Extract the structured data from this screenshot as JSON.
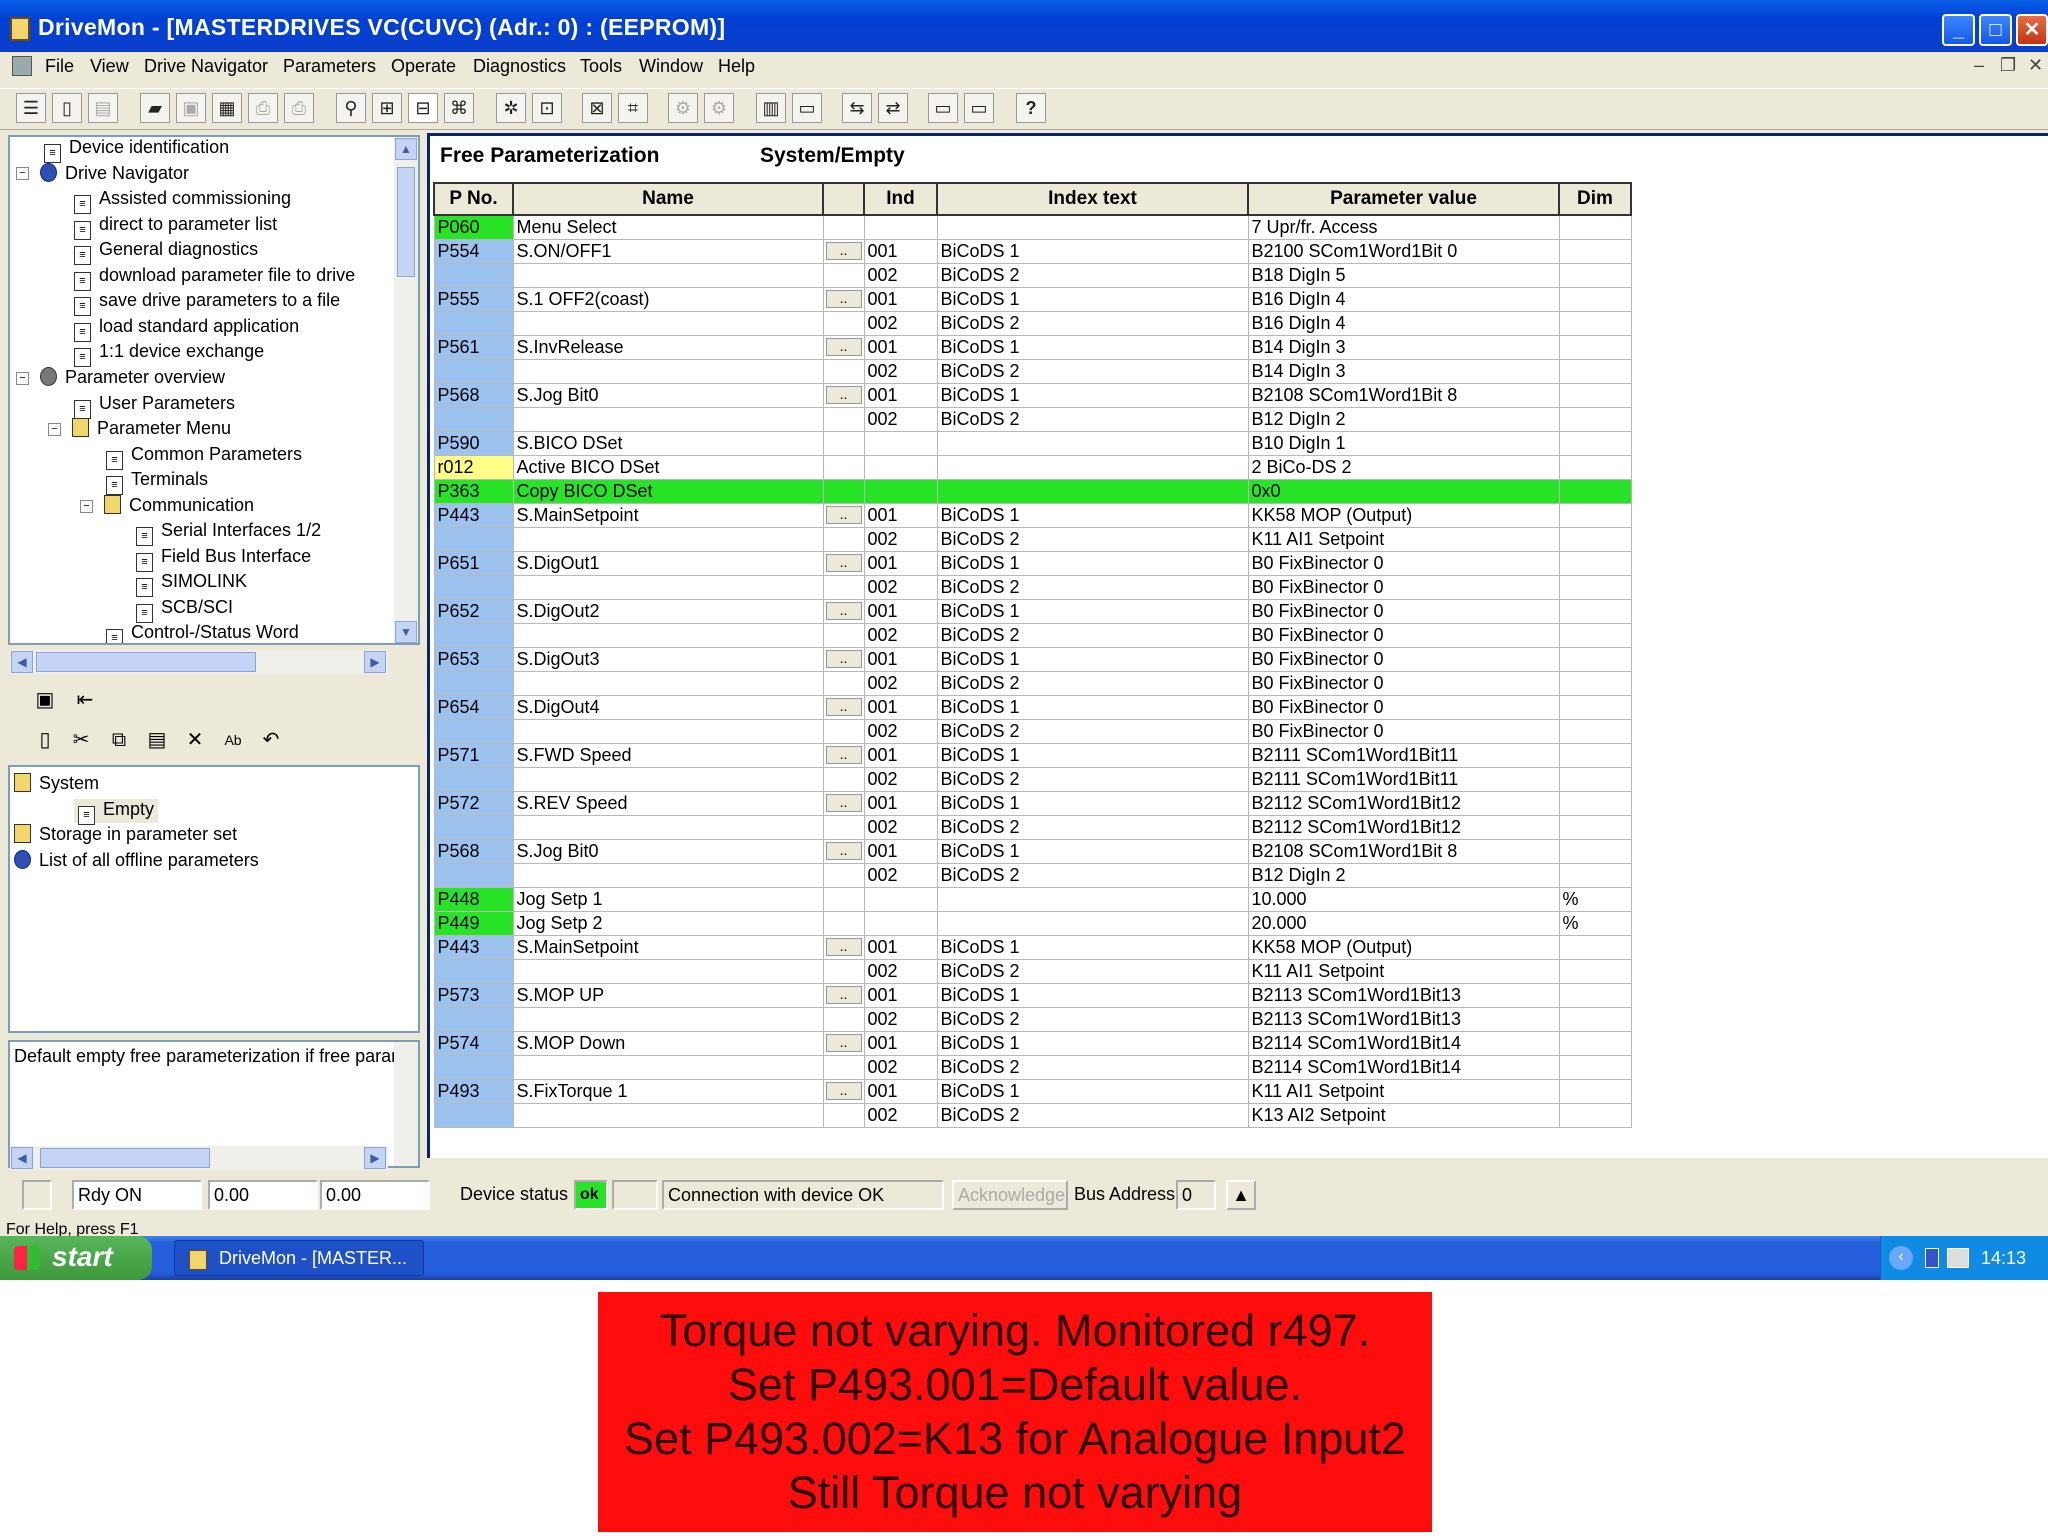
{
  "window": {
    "title": "DriveMon - [MASTERDRIVES VC(CUVC)  (Adr.: 0) : (EEPROM)]"
  },
  "menu": [
    "File",
    "View",
    "Drive Navigator",
    "Parameters",
    "Operate",
    "Diagnostics",
    "Tools",
    "Window",
    "Help"
  ],
  "tree": {
    "items": [
      "Device identification",
      "Drive Navigator",
      "Assisted commissioning",
      "direct to parameter list",
      "General diagnostics",
      "download parameter file to drive",
      "save drive parameters to a file",
      "load standard application",
      "1:1 device exchange",
      "Parameter overview",
      "User Parameters",
      "Parameter Menu",
      "Common Parameters",
      "Terminals",
      "Communication",
      "Serial Interfaces 1/2",
      "Field Bus Interface",
      "SIMOLINK",
      "SCB/SCI",
      "Control-/Status Word"
    ]
  },
  "paramsets": {
    "items": [
      "System",
      "Empty",
      "Storage in parameter set",
      "List of all offline parameters"
    ]
  },
  "description": "Default empty free parameterization if free parame",
  "grid": {
    "title": "Free Parameterization",
    "subtitle": "System/Empty",
    "headers": [
      "P No.",
      "Name",
      "",
      "Ind",
      "Index text",
      "Parameter value",
      "Dim"
    ],
    "rows": [
      {
        "p": "P060",
        "name": "Menu Select",
        "btn": "",
        "ind": "",
        "itext": "",
        "val": "7  Upr/fr. Access",
        "dim": "",
        "pc": "green"
      },
      {
        "p": "P554",
        "name": "S.ON/OFF1",
        "btn": "..",
        "ind": "001",
        "itext": "BiCoDS 1",
        "val": "B2100  SCom1Word1Bit 0",
        "dim": "",
        "pc": "blue"
      },
      {
        "p": "",
        "name": "",
        "btn": "",
        "ind": "002",
        "itext": "BiCoDS 2",
        "val": "B18  DigIn 5",
        "dim": "",
        "pc": "blue"
      },
      {
        "p": "P555",
        "name": "S.1 OFF2(coast)",
        "btn": "..",
        "ind": "001",
        "itext": "BiCoDS 1",
        "val": "B16  DigIn 4",
        "dim": "",
        "pc": "blue"
      },
      {
        "p": "",
        "name": "",
        "btn": "",
        "ind": "002",
        "itext": "BiCoDS 2",
        "val": "B16  DigIn 4",
        "dim": "",
        "pc": "blue"
      },
      {
        "p": "P561",
        "name": "S.InvRelease",
        "btn": "..",
        "ind": "001",
        "itext": "BiCoDS 1",
        "val": "B14  DigIn 3",
        "dim": "",
        "pc": "blue"
      },
      {
        "p": "",
        "name": "",
        "btn": "",
        "ind": "002",
        "itext": "BiCoDS 2",
        "val": "B14  DigIn 3",
        "dim": "",
        "pc": "blue"
      },
      {
        "p": "P568",
        "name": "S.Jog Bit0",
        "btn": "..",
        "ind": "001",
        "itext": "BiCoDS 1",
        "val": "B2108  SCom1Word1Bit 8",
        "dim": "",
        "pc": "blue"
      },
      {
        "p": "",
        "name": "",
        "btn": "",
        "ind": "002",
        "itext": "BiCoDS 2",
        "val": "B12  DigIn 2",
        "dim": "",
        "pc": "blue"
      },
      {
        "p": "P590",
        "name": "S.BICO DSet",
        "btn": "",
        "ind": "",
        "itext": "",
        "val": "B10  DigIn 1",
        "dim": "",
        "pc": "blue"
      },
      {
        "p": "r012",
        "name": "Active BICO DSet",
        "btn": "",
        "ind": "",
        "itext": "",
        "val": "2   BiCo-DS 2",
        "dim": "",
        "pc": "yellow"
      },
      {
        "p": "P363",
        "name": "Copy BICO DSet",
        "btn": "",
        "ind": "",
        "itext": "",
        "val": "0x0",
        "dim": "",
        "pc": "green",
        "hl": true
      },
      {
        "p": "P443",
        "name": "S.MainSetpoint",
        "btn": "..",
        "ind": "001",
        "itext": "BiCoDS 1",
        "val": "KK58  MOP (Output)",
        "dim": "",
        "pc": "blue"
      },
      {
        "p": "",
        "name": "",
        "btn": "",
        "ind": "002",
        "itext": "BiCoDS 2",
        "val": "K11  AI1 Setpoint",
        "dim": "",
        "pc": "blue"
      },
      {
        "p": "P651",
        "name": "S.DigOut1",
        "btn": "..",
        "ind": "001",
        "itext": "BiCoDS 1",
        "val": "B0  FixBinector 0",
        "dim": "",
        "pc": "blue"
      },
      {
        "p": "",
        "name": "",
        "btn": "",
        "ind": "002",
        "itext": "BiCoDS 2",
        "val": "B0  FixBinector 0",
        "dim": "",
        "pc": "blue"
      },
      {
        "p": "P652",
        "name": "S.DigOut2",
        "btn": "..",
        "ind": "001",
        "itext": "BiCoDS 1",
        "val": "B0  FixBinector 0",
        "dim": "",
        "pc": "blue"
      },
      {
        "p": "",
        "name": "",
        "btn": "",
        "ind": "002",
        "itext": "BiCoDS 2",
        "val": "B0  FixBinector 0",
        "dim": "",
        "pc": "blue"
      },
      {
        "p": "P653",
        "name": "S.DigOut3",
        "btn": "..",
        "ind": "001",
        "itext": "BiCoDS 1",
        "val": "B0  FixBinector 0",
        "dim": "",
        "pc": "blue"
      },
      {
        "p": "",
        "name": "",
        "btn": "",
        "ind": "002",
        "itext": "BiCoDS 2",
        "val": "B0  FixBinector 0",
        "dim": "",
        "pc": "blue"
      },
      {
        "p": "P654",
        "name": "S.DigOut4",
        "btn": "..",
        "ind": "001",
        "itext": "BiCoDS 1",
        "val": "B0  FixBinector 0",
        "dim": "",
        "pc": "blue"
      },
      {
        "p": "",
        "name": "",
        "btn": "",
        "ind": "002",
        "itext": "BiCoDS 2",
        "val": "B0  FixBinector 0",
        "dim": "",
        "pc": "blue"
      },
      {
        "p": "P571",
        "name": "S.FWD Speed",
        "btn": "..",
        "ind": "001",
        "itext": "BiCoDS 1",
        "val": "B2111  SCom1Word1Bit11",
        "dim": "",
        "pc": "blue"
      },
      {
        "p": "",
        "name": "",
        "btn": "",
        "ind": "002",
        "itext": "BiCoDS 2",
        "val": "B2111  SCom1Word1Bit11",
        "dim": "",
        "pc": "blue"
      },
      {
        "p": "P572",
        "name": "S.REV Speed",
        "btn": "..",
        "ind": "001",
        "itext": "BiCoDS 1",
        "val": "B2112  SCom1Word1Bit12",
        "dim": "",
        "pc": "blue"
      },
      {
        "p": "",
        "name": "",
        "btn": "",
        "ind": "002",
        "itext": "BiCoDS 2",
        "val": "B2112  SCom1Word1Bit12",
        "dim": "",
        "pc": "blue"
      },
      {
        "p": "P568",
        "name": "S.Jog Bit0",
        "btn": "..",
        "ind": "001",
        "itext": "BiCoDS 1",
        "val": "B2108  SCom1Word1Bit 8",
        "dim": "",
        "pc": "blue"
      },
      {
        "p": "",
        "name": "",
        "btn": "",
        "ind": "002",
        "itext": "BiCoDS 2",
        "val": "B12  DigIn 2",
        "dim": "",
        "pc": "blue"
      },
      {
        "p": "P448",
        "name": "Jog Setp 1",
        "btn": "",
        "ind": "",
        "itext": "",
        "val": "10.000",
        "dim": "%",
        "pc": "green"
      },
      {
        "p": "P449",
        "name": "Jog Setp 2",
        "btn": "",
        "ind": "",
        "itext": "",
        "val": "20.000",
        "dim": "%",
        "pc": "green"
      },
      {
        "p": "P443",
        "name": "S.MainSetpoint",
        "btn": "..",
        "ind": "001",
        "itext": "BiCoDS 1",
        "val": "KK58  MOP (Output)",
        "dim": "",
        "pc": "blue"
      },
      {
        "p": "",
        "name": "",
        "btn": "",
        "ind": "002",
        "itext": "BiCoDS 2",
        "val": "K11  AI1 Setpoint",
        "dim": "",
        "pc": "blue"
      },
      {
        "p": "P573",
        "name": "S.MOP UP",
        "btn": "..",
        "ind": "001",
        "itext": "BiCoDS 1",
        "val": "B2113  SCom1Word1Bit13",
        "dim": "",
        "pc": "blue"
      },
      {
        "p": "",
        "name": "",
        "btn": "",
        "ind": "002",
        "itext": "BiCoDS 2",
        "val": "B2113  SCom1Word1Bit13",
        "dim": "",
        "pc": "blue"
      },
      {
        "p": "P574",
        "name": "S.MOP Down",
        "btn": "..",
        "ind": "001",
        "itext": "BiCoDS 1",
        "val": "B2114  SCom1Word1Bit14",
        "dim": "",
        "pc": "blue"
      },
      {
        "p": "",
        "name": "",
        "btn": "",
        "ind": "002",
        "itext": "BiCoDS 2",
        "val": "B2114  SCom1Word1Bit14",
        "dim": "",
        "pc": "blue"
      },
      {
        "p": "P493",
        "name": "S.FixTorque 1",
        "btn": "..",
        "ind": "001",
        "itext": "BiCoDS 1",
        "val": "K11  AI1 Setpoint",
        "dim": "",
        "pc": "blue"
      },
      {
        "p": "",
        "name": "",
        "btn": "",
        "ind": "002",
        "itext": "BiCoDS 2",
        "val": "K13  AI2 Setpoint",
        "dim": "",
        "pc": "blue"
      }
    ]
  },
  "status": {
    "rdy": "Rdy ON",
    "val1": "0.00",
    "val2": "0.00",
    "device_status_label": "Device status",
    "ok": "ok",
    "connection": "Connection with device OK",
    "acknowledge": "Acknowledge",
    "bus_label": "Bus Address",
    "bus_value": "0",
    "help": "For Help, press F1"
  },
  "taskbar": {
    "start": "start",
    "item": "DriveMon - [MASTER...",
    "clock": "14:13"
  },
  "note": {
    "lines": [
      "Torque not varying. Monitored r497.",
      "Set P493.001=Default value.",
      "Set P493.002=K13 for Analogue Input2",
      "Still Torque not varying"
    ]
  },
  "colors": {
    "param_blue": "#9cc3f0",
    "param_green": "#27e427",
    "param_yellow": "#ffff88",
    "note_red": "#ff0d0d"
  }
}
